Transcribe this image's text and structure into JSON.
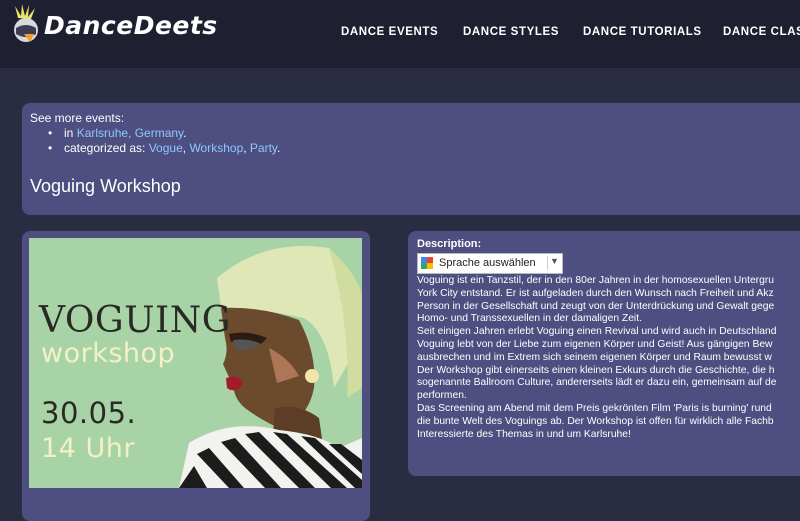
{
  "site": {
    "name": "DanceDeets",
    "logo_icon": "dancer-logo-icon"
  },
  "nav": [
    {
      "label": "DANCE EVENTS"
    },
    {
      "label": "DANCE STYLES"
    },
    {
      "label": "DANCE TUTORIALS"
    },
    {
      "label": "DANCE CLASS"
    }
  ],
  "more": {
    "label": "See more events:",
    "location_prefix": "in ",
    "location": "Karlsruhe, Germany",
    "location_suffix": ".",
    "category_prefix": "categorized as: ",
    "categories": [
      "Vogue",
      "Workshop",
      "Party"
    ],
    "category_sep": ", ",
    "category_suffix": "."
  },
  "event": {
    "title": "Voguing Workshop"
  },
  "poster": {
    "title": "VOGUING",
    "subtitle": "workshop",
    "date": "30.05.",
    "time": "14 Uhr"
  },
  "description": {
    "label": "Description:",
    "translate_label": "Sprache auswählen",
    "lines": [
      "Voguing ist ein Tanzstil, der in den 80er Jahren in der homosexuellen Untergru",
      "York City entstand. Er ist aufgeladen durch den Wunsch nach Freiheit und Akz",
      "Person in der Gesellschaft und zeugt von der Unterdrückung und Gewalt gege",
      "Homo- und Transsexuellen in der damaligen Zeit.",
      "Seit einigen Jahren erlebt Voguing einen Revival und wird auch in Deutschland",
      "Voguing lebt von der Liebe zum eigenen Körper und Geist! Aus gängigen Bew",
      "ausbrechen und im Extrem sich seinem eigenen Körper und Raum bewusst w",
      "Der Workshop gibt einerseits einen kleinen Exkurs durch die Geschichte, die h",
      "sogenannte Ballroom Culture, andererseits lädt er dazu ein, gemeinsam auf de",
      "performen.",
      "Das Screening am Abend mit dem Preis gekrönten Film 'Paris is burning' rund",
      "die bunte Welt des Voguings ab. Der Workshop ist offen für wirklich alle Fachb",
      "Interessierte des Themas in und um Karlsruhe!"
    ]
  },
  "colors": {
    "page_bg": "#2a2c42",
    "header_bg": "#1e1f31",
    "panel_bg": "#4e4e80",
    "link": "#8ec8ff",
    "poster_bg": "#a8d3a6"
  }
}
